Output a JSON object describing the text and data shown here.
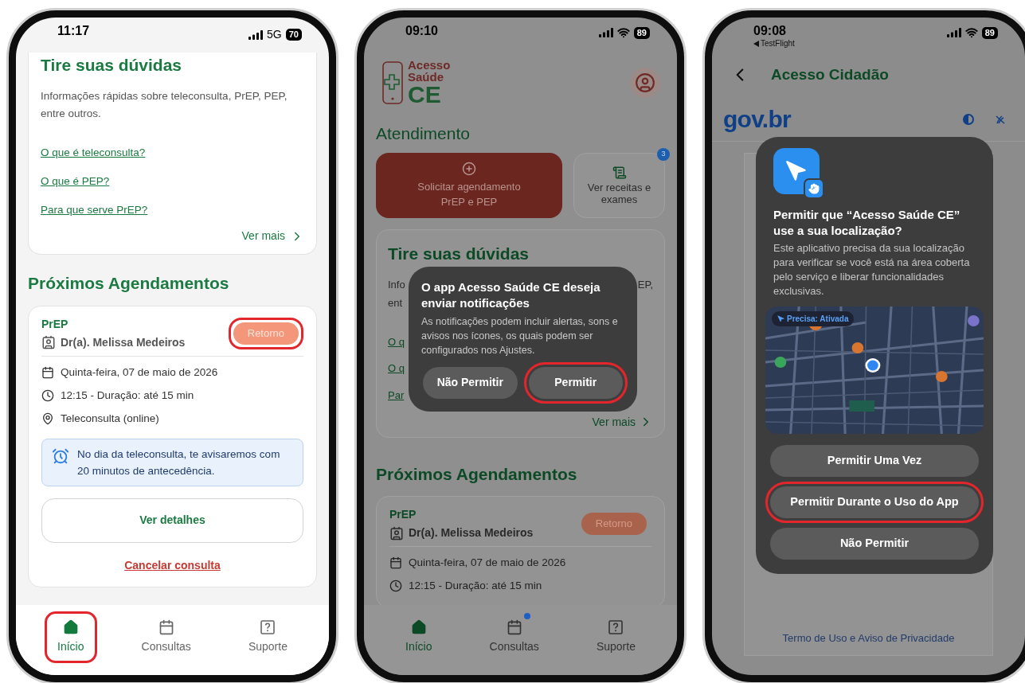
{
  "phones": [
    {
      "kind": "home_scrolled",
      "status": {
        "time": "11:17",
        "network": "5G",
        "wifi": false,
        "battery": "70"
      },
      "faq": {
        "title": "Tire suas dúvidas",
        "description": "Informações rápidas sobre teleconsulta, PrEP, PEP, entre outros.",
        "links": [
          "O que é teleconsulta?",
          "O que é PEP?",
          "Para que serve PrEP?"
        ],
        "more": "Ver mais"
      },
      "appointments_title": "Próximos Agendamentos",
      "appointment": {
        "type": "PrEP",
        "doctor": "Dr(a). Melissa Medeiros",
        "badge": "Retorno",
        "badge_highlighted": true,
        "details": [
          {
            "kind": "date",
            "text": "Quinta-feira, 07 de maio de 2026"
          },
          {
            "kind": "time",
            "text": "12:15 - Duração: até 15 min"
          },
          {
            "kind": "place",
            "text": "Teleconsulta (online)"
          }
        ],
        "notice": "No dia da teleconsulta, te avisaremos com 20 minutos de antecedência.",
        "details_button": "Ver detalhes",
        "cancel_link": "Cancelar consulta"
      },
      "nav": [
        {
          "kind": "home",
          "label": "Início",
          "selected": true,
          "highlighted": true,
          "dot": false
        },
        {
          "kind": "calendar",
          "label": "Consultas",
          "selected": false,
          "highlighted": false,
          "dot": false
        },
        {
          "kind": "help",
          "label": "Suporte",
          "selected": false,
          "highlighted": false,
          "dot": false
        }
      ]
    },
    {
      "kind": "home_alert",
      "status": {
        "time": "09:10",
        "wifi": true,
        "battery": "89"
      },
      "logo": {
        "line_1": "Acesso",
        "line_2": "Saúde",
        "line_3": "CE"
      },
      "section_title": "Atendimento",
      "actions": [
        {
          "kind": "primary",
          "label": "Solicitar agendamento PrEP e PEP"
        },
        {
          "kind": "secondary",
          "label": "Ver receitas e exames",
          "badge": "3"
        }
      ],
      "faq": {
        "title": "Tire suas dúvidas",
        "intro_left": "Info",
        "intro_right": "EP,",
        "intro_line_2": "ent",
        "links": [
          "O q",
          "O q",
          "Par"
        ],
        "more": "Ver mais"
      },
      "appointments_title": "Próximos Agendamentos",
      "appointment": {
        "type": "PrEP",
        "doctor": "Dr(a). Melissa Medeiros",
        "badge": "Retorno",
        "badge_highlighted": false,
        "details": [
          {
            "kind": "date",
            "text": "Quinta-feira, 07 de maio de 2026"
          },
          {
            "kind": "time",
            "text": "12:15 - Duração: até 15 min"
          }
        ]
      },
      "alert": {
        "title": "O app Acesso Saúde CE deseja enviar notificações",
        "message": "As notificações podem incluir alertas, sons e avisos nos ícones, os quais podem ser configurados nos Ajustes.",
        "buttons": [
          {
            "label": "Não Permitir",
            "highlighted": false
          },
          {
            "label": "Permitir",
            "highlighted": true
          }
        ]
      },
      "nav": [
        {
          "kind": "home",
          "label": "Início",
          "selected": true,
          "highlighted": false,
          "dot": false
        },
        {
          "kind": "calendar",
          "label": "Consultas",
          "selected": false,
          "highlighted": false,
          "dot": true
        },
        {
          "kind": "help",
          "label": "Suporte",
          "selected": false,
          "highlighted": false,
          "dot": false
        }
      ]
    },
    {
      "kind": "location_prompt",
      "status": {
        "time": "09:08",
        "wifi": true,
        "battery": "89",
        "back_app": "TestFlight"
      },
      "header": {
        "title": "Acesso Cidadão"
      },
      "gov_logo": "gov.br",
      "footer_link": "Termo de Uso e Aviso de Privacidade",
      "alert": {
        "title": "Permitir que “Acesso Saúde CE” use a sua localização?",
        "message": "Este aplicativo precisa da sua localização para verificar se você está na área coberta pelo serviço e liberar funcionalidades exclusivas.",
        "precision": "Precisa: Ativada",
        "buttons": [
          {
            "label": "Permitir Uma Vez",
            "highlighted": false
          },
          {
            "label": "Permitir Durante o Uso do App",
            "highlighted": true
          },
          {
            "label": "Não Permitir",
            "highlighted": false
          }
        ]
      }
    }
  ]
}
